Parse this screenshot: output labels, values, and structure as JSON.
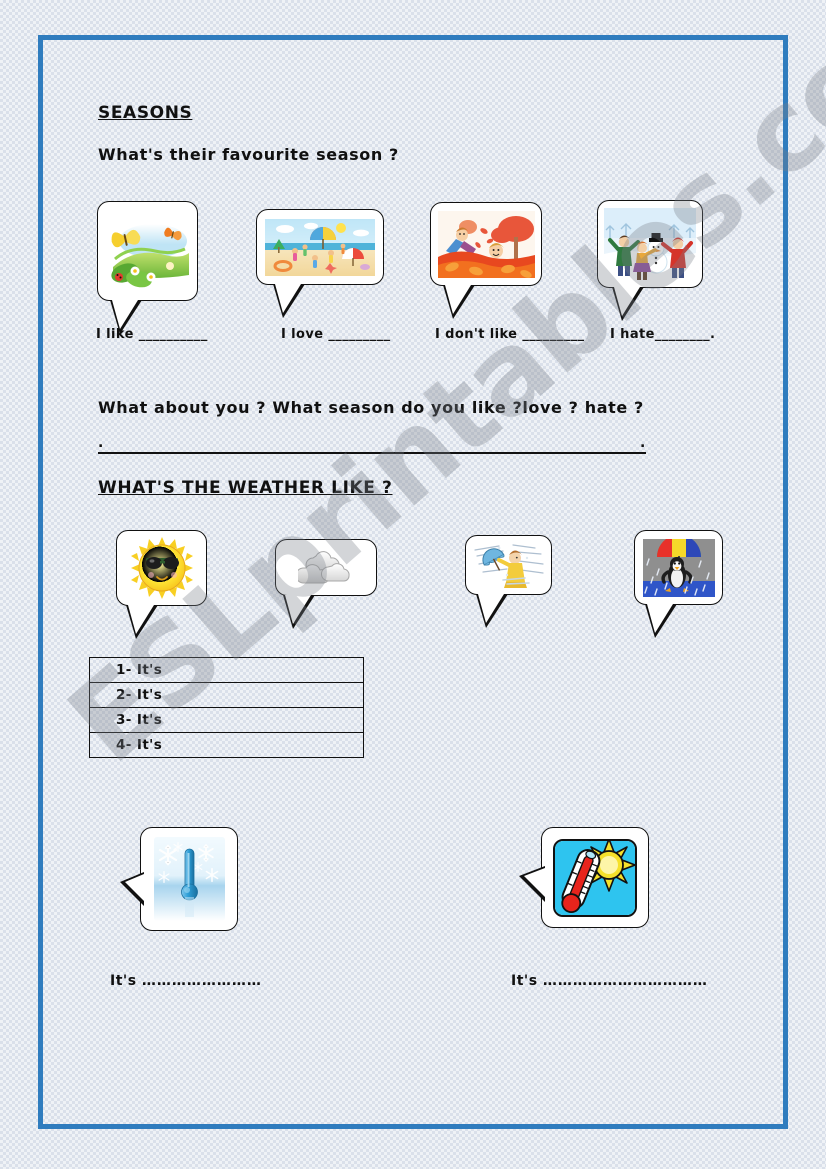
{
  "page": {
    "frame_color": "#2f7cbe",
    "background_color": "#eff2f6",
    "watermark": "ESLprintables.com"
  },
  "seasons_section": {
    "heading": "SEASONS",
    "question": "What's their favourite season ?",
    "items": [
      {
        "image": "spring-butterflies-flowers-image",
        "prompt": "I like",
        "blank": "__________",
        "trailing": ""
      },
      {
        "image": "summer-beach-children-image",
        "prompt": "I love",
        "blank": "_________",
        "trailing": ""
      },
      {
        "image": "autumn-children-leaves-image",
        "prompt": "I don't like",
        "blank": "_________",
        "trailing": ""
      },
      {
        "image": "winter-children-snowman-image",
        "prompt": "I hate",
        "blank": "________",
        "trailing": "."
      }
    ]
  },
  "about_you_section": {
    "question": "What about you ? What season do you like ?love ? hate ?",
    "answer_line_start_dot": ".",
    "answer_line_end_dot": "."
  },
  "weather_section": {
    "heading": "WHAT'S THE WEATHER LIKE ?",
    "items": [
      {
        "image": "sunny-sun-sunglasses-image"
      },
      {
        "image": "cloudy-clouds-image"
      },
      {
        "image": "windy-person-umbrella-image"
      },
      {
        "image": "rainy-penguin-umbrella-image"
      }
    ],
    "answers": [
      {
        "label": "1- It's"
      },
      {
        "label": "2- It's"
      },
      {
        "label": "3- It's"
      },
      {
        "label": "4- It's"
      }
    ]
  },
  "temperature_section": {
    "items": [
      {
        "image": "cold-thermometer-snowflakes-image",
        "prompt": "It's",
        "dots": "……………………"
      },
      {
        "image": "hot-thermometer-sun-image",
        "prompt": "It's",
        "dots": "……………………………"
      }
    ]
  }
}
